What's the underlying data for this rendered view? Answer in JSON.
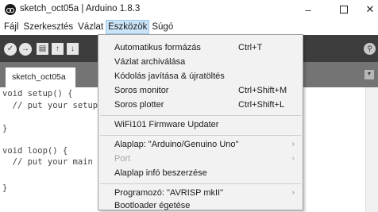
{
  "window": {
    "title": "sketch_oct05a | Arduino 1.8.3",
    "minimize_glyph": "–",
    "close_glyph": "✕"
  },
  "menubar": {
    "items": [
      "Fájl",
      "Szerkesztés",
      "Vázlat",
      "Eszközök",
      "Súgó"
    ],
    "active": "Eszközök"
  },
  "toolbar": {
    "verify_glyph": "✓",
    "upload_glyph": "→",
    "new_glyph": "▤",
    "open_glyph": "↑",
    "save_glyph": "↓",
    "serial_glyph": "⚲"
  },
  "tabs": {
    "items": [
      "sketch_oct05a"
    ],
    "menu_glyph": "▼"
  },
  "editor": {
    "lines": [
      "void setup() {",
      "  // put your setup code here, to run once:",
      "",
      "}",
      "",
      "void loop() {",
      "  // put your main code here, to run repeatedly:",
      "",
      "}"
    ]
  },
  "tools_menu": {
    "items": [
      {
        "label": "Automatikus formázás",
        "shortcut": "Ctrl+T",
        "submenu": false,
        "disabled": false
      },
      {
        "label": "Vázlat archiválása",
        "shortcut": "",
        "submenu": false,
        "disabled": false
      },
      {
        "label": "Kódolás javítása & újratöltés",
        "shortcut": "",
        "submenu": false,
        "disabled": false
      },
      {
        "label": "Soros monitor",
        "shortcut": "Ctrl+Shift+M",
        "submenu": false,
        "disabled": false
      },
      {
        "label": "Soros plotter",
        "shortcut": "Ctrl+Shift+L",
        "submenu": false,
        "disabled": false
      },
      {
        "label": "WiFi101 Firmware Updater",
        "shortcut": "",
        "submenu": false,
        "disabled": false
      },
      {
        "label": "Alaplap: \"Arduino/Genuino Uno\"",
        "shortcut": "",
        "submenu": true,
        "disabled": false
      },
      {
        "label": "Port",
        "shortcut": "",
        "submenu": true,
        "disabled": true
      },
      {
        "label": "Alaplap infó beszerzése",
        "shortcut": "",
        "submenu": false,
        "disabled": false
      },
      {
        "label": "Programozó: \"AVRISP mkII\"",
        "shortcut": "",
        "submenu": true,
        "disabled": false
      },
      {
        "label": "Bootloader égetése",
        "shortcut": "",
        "submenu": false,
        "disabled": false
      }
    ],
    "submenu_glyph": "›"
  }
}
